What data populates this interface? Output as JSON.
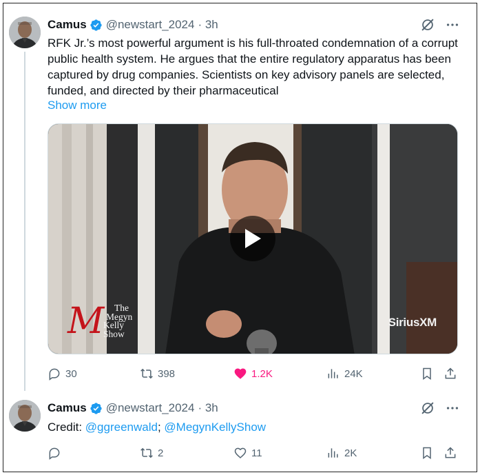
{
  "thread": [
    {
      "author": {
        "name": "Camus",
        "handle": "@newstart_2024",
        "time": "· 3h",
        "verified": true
      },
      "text": "RFK Jr.’s most powerful argument is his full-throated condemnation of a corrupt public health system. He argues that the entire regulatory apparatus has been captured by drug companies. Scientists on key advisory panels are selected, funded, and directed by their pharmaceutical",
      "show_more": "Show more",
      "media": {
        "show_logo_lines": [
          "The",
          "Megyn",
          "Kelly",
          "Show"
        ],
        "broadcaster": "SiriusXM"
      },
      "stats": {
        "replies": "30",
        "reposts": "398",
        "likes": "1.2K",
        "views": "24K",
        "liked": true
      }
    },
    {
      "author": {
        "name": "Camus",
        "handle": "@newstart_2024",
        "time": "· 3h",
        "verified": true
      },
      "credit_prefix": "Credit: ",
      "mention1": "@ggreenwald",
      "separator": "; ",
      "mention2": "@MegynKellyShow",
      "stats": {
        "replies": "",
        "reposts": "2",
        "likes": "11",
        "views": "2K",
        "liked": false
      }
    }
  ],
  "colors": {
    "accent": "#1d9bf0",
    "like": "#f91880",
    "muted": "#536471",
    "verified": "#1d9bf0"
  },
  "icons": [
    "grok-icon",
    "more-icon",
    "reply-icon",
    "repost-icon",
    "like-icon",
    "views-icon",
    "bookmark-icon",
    "share-icon",
    "play-icon",
    "verified-badge-icon"
  ]
}
